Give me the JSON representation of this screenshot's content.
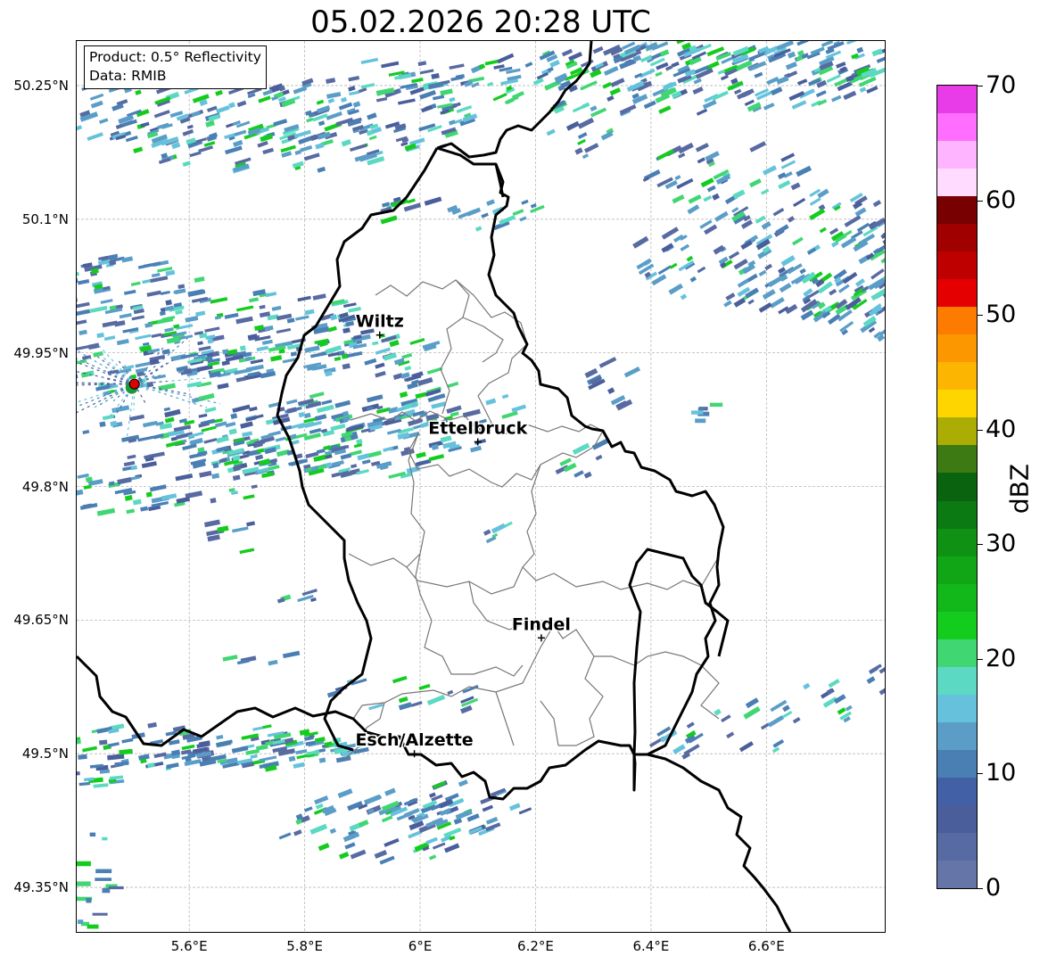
{
  "title": "05.02.2026 20:28 UTC",
  "info_box": {
    "line1": "Product: 0.5° Reflectivity",
    "line2": "Data: RMIB"
  },
  "lat_labels": [
    "50.25°N",
    "50.1°N",
    "49.95°N",
    "49.8°N",
    "49.65°N",
    "49.5°N",
    "49.35°N"
  ],
  "lon_labels": [
    "5.6°E",
    "5.8°E",
    "6°E",
    "6.2°E",
    "6.4°E",
    "6.6°E"
  ],
  "cities": [
    {
      "name": "Wiltz",
      "lon": 5.93,
      "lat": 49.97
    },
    {
      "name": "Ettelbruck",
      "lon": 6.1,
      "lat": 49.85
    },
    {
      "name": "Findel",
      "lon": 6.21,
      "lat": 49.63
    },
    {
      "name": "Esch/Alzette",
      "lon": 5.99,
      "lat": 49.5
    }
  ],
  "colorbar": {
    "label": "dBZ",
    "tick_labels": [
      "0",
      "10",
      "20",
      "30",
      "40",
      "50",
      "60",
      "70"
    ],
    "colors": [
      "#6675a8",
      "#586aa2",
      "#4a5e9c",
      "#4160a6",
      "#4a7fb4",
      "#5a9ec8",
      "#66c2dc",
      "#5cd9c2",
      "#40d672",
      "#14cc1e",
      "#12b81a",
      "#10a616",
      "#0f9214",
      "#0c7a12",
      "#0a640f",
      "#3e7a14",
      "#acad04",
      "#ffd500",
      "#fcb500",
      "#fc9700",
      "#fc7b00",
      "#e40000",
      "#be0000",
      "#a00000",
      "#780000",
      "#ffdcff",
      "#ffb4ff",
      "#ff6eff",
      "#e83ce8"
    ]
  },
  "radar_site": {
    "lon": 5.505,
    "lat": 49.915
  },
  "map_bounds": {
    "lon_min": 5.405,
    "lon_max": 6.805,
    "lat_min": 49.3,
    "lat_max": 50.3
  }
}
